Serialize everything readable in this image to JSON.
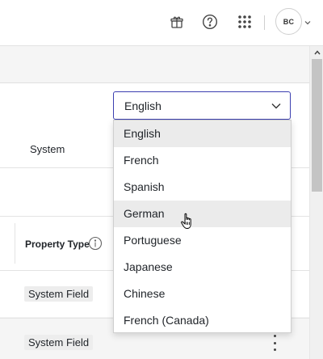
{
  "topbar": {
    "icons": [
      "gift-box-icon",
      "help-circle-icon",
      "app-launcher-grid-icon"
    ],
    "avatar_initials": "BC"
  },
  "table": {
    "row1_text": "System",
    "header_property_type": "Property Type",
    "badges": [
      "System Field",
      "System Field"
    ]
  },
  "language_select": {
    "value": "English",
    "options": [
      "English",
      "French",
      "Spanish",
      "German",
      "Portuguese",
      "Japanese",
      "Chinese",
      "French (Canada)"
    ],
    "selected_index": 0,
    "hovered_index": 3
  },
  "colors": {
    "select_border": "#3b3fb0",
    "option_highlight": "#ebebeb",
    "badge_bg": "#ededed"
  }
}
